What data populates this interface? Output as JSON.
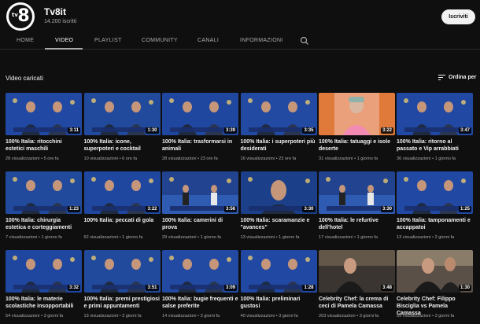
{
  "channel": {
    "name": "Tv8it",
    "subscribers": "14.200 iscritti",
    "subscribe_label": "Iscriviti",
    "logo_text": "tv",
    "logo_number": "8"
  },
  "tabs": [
    {
      "label": "HOME"
    },
    {
      "label": "VIDEO"
    },
    {
      "label": "PLAYLIST"
    },
    {
      "label": "COMMUNITY"
    },
    {
      "label": "CANALI"
    },
    {
      "label": "INFORMAZIONI"
    }
  ],
  "active_tab": "VIDEO",
  "section": {
    "title": "Video caricati",
    "sort_label": "Ordina per"
  },
  "videos": [
    {
      "title": "100% Italia: ritocchini estetici maschili",
      "meta": "28 visualizzazioni • 5 ore fa",
      "duration": "3:11",
      "bg": "#1d3d8f",
      "accent": "#2f6be0",
      "kind": "studio"
    },
    {
      "title": "100% Italia: icone, superpoteri e cocktail",
      "meta": "10 visualizzazioni • 6 ore fa",
      "duration": "1:30",
      "bg": "#1a3a8a",
      "accent": "#3a7bd5",
      "kind": "studio"
    },
    {
      "title": "100% Italia: trasformarsi in animali",
      "meta": "28 visualizzazioni • 23 ore fa",
      "duration": "3:39",
      "bg": "#1b3c8c",
      "accent": "#2c67d8",
      "kind": "studio"
    },
    {
      "title": "100% Italia: i superpoteri più desiderati",
      "meta": "16 visualizzazioni • 23 ore fa",
      "duration": "3:35",
      "bg": "#1c3e90",
      "accent": "#3271dc",
      "kind": "studio"
    },
    {
      "title": "100% Italia: tatuaggi e isole deserte",
      "meta": "31 visualizzazioni • 1 giorno fa",
      "duration": "3:22",
      "bg": "#e07a3a",
      "accent": "#f4a261",
      "kind": "orange"
    },
    {
      "title": "100% Italia: ritorno al passato e Vip arrabbiati",
      "meta": "36 visualizzazioni • 1 giorno fa",
      "duration": "3:47",
      "bg": "#1d3d8f",
      "accent": "#2f6be0",
      "kind": "studio"
    },
    {
      "title": "100% Italia: chirurgia estetica e corteggiamenti",
      "meta": "7 visualizzazioni • 1 giorno fa",
      "duration": "1:23",
      "bg": "#1a3a8a",
      "accent": "#3a7bd5",
      "kind": "studio"
    },
    {
      "title": "100% Italia: peccati di gola",
      "meta": "62 visualizzazioni • 1 giorno fa",
      "duration": "3:22",
      "bg": "#1b3c8c",
      "accent": "#2c67d8",
      "kind": "studio"
    },
    {
      "title": "100% Italia: camerini di prova",
      "meta": "29 visualizzazioni • 1 giorno fa",
      "duration": "3:56",
      "bg": "#1a3478",
      "accent": "#3b6fd2",
      "kind": "stage"
    },
    {
      "title": "100% Italia: scaramanzie e \"avances\"",
      "meta": "13 visualizzazioni • 1 giorno fa",
      "duration": "3:30",
      "bg": "#163575",
      "accent": "#2a5fc4",
      "kind": "closeup"
    },
    {
      "title": "100% Italia: le refurtive dell'hotel",
      "meta": "17 visualizzazioni • 1 giorno fa",
      "duration": "3:30",
      "bg": "#1a3478",
      "accent": "#3b6fd2",
      "kind": "stage"
    },
    {
      "title": "100% Italia: tamponamenti e accappatoi",
      "meta": "13 visualizzazioni • 2 giorni fa",
      "duration": "1:25",
      "bg": "#1d3d8f",
      "accent": "#2f6be0",
      "kind": "studio"
    },
    {
      "title": "100% Italia: le materie scolastiche insopportabili",
      "meta": "54 visualizzazioni • 3 giorni fa",
      "duration": "3:32",
      "bg": "#1b3c8c",
      "accent": "#2c67d8",
      "kind": "studio"
    },
    {
      "title": "100% Italia: premi prestigiosi e primi appuntamenti",
      "meta": "13 visualizzazioni • 3 giorni fa",
      "duration": "3:51",
      "bg": "#1a3a8a",
      "accent": "#3a7bd5",
      "kind": "studio"
    },
    {
      "title": "100% Italia: bugie frequenti e salse preferite",
      "meta": "14 visualizzazioni • 3 giorni fa",
      "duration": "3:09",
      "bg": "#1c3e90",
      "accent": "#3271dc",
      "kind": "studio"
    },
    {
      "title": "100% Italia: preliminari gustosi",
      "meta": "40 visualizzazioni • 3 giorni fa",
      "duration": "1:28",
      "bg": "#1d3d8f",
      "accent": "#2f6be0",
      "kind": "studio"
    },
    {
      "title": "Celebrity Chef: la crema di ceci di Pamela Camassa",
      "meta": "263 visualizzazioni • 3 giorni fa",
      "duration": "3:48",
      "bg": "#3a3530",
      "accent": "#8a7a60",
      "kind": "chef"
    },
    {
      "title": "Celebrity Chef: Filippo Bisciglia vs Pamela Camassa",
      "meta": "59 visualizzazioni • 3 giorni fa",
      "duration": "1:30",
      "bg": "#5a5048",
      "accent": "#b8a88a",
      "kind": "chef2"
    }
  ]
}
